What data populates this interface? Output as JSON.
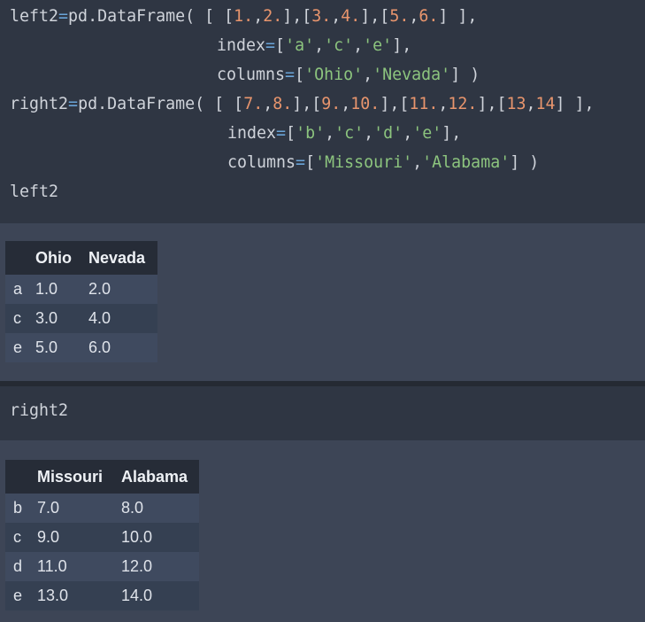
{
  "cell1": {
    "lines": [
      [
        {
          "t": "ident",
          "v": "left2"
        },
        {
          "t": "op",
          "v": "="
        },
        {
          "t": "ident",
          "v": "pd"
        },
        {
          "t": "punc",
          "v": "."
        },
        {
          "t": "ident",
          "v": "DataFrame"
        },
        {
          "t": "punc",
          "v": "( [ ["
        },
        {
          "t": "num",
          "v": "1."
        },
        {
          "t": "punc",
          "v": ","
        },
        {
          "t": "num",
          "v": "2."
        },
        {
          "t": "punc",
          "v": "],["
        },
        {
          "t": "num",
          "v": "3."
        },
        {
          "t": "punc",
          "v": ","
        },
        {
          "t": "num",
          "v": "4."
        },
        {
          "t": "punc",
          "v": "],["
        },
        {
          "t": "num",
          "v": "5."
        },
        {
          "t": "punc",
          "v": ","
        },
        {
          "t": "num",
          "v": "6."
        },
        {
          "t": "punc",
          "v": "] ],"
        }
      ],
      [
        {
          "t": "ident",
          "v": "index"
        },
        {
          "t": "op",
          "v": "="
        },
        {
          "t": "punc",
          "v": "["
        },
        {
          "t": "str",
          "v": "'a'"
        },
        {
          "t": "punc",
          "v": ","
        },
        {
          "t": "str",
          "v": "'c'"
        },
        {
          "t": "punc",
          "v": ","
        },
        {
          "t": "str",
          "v": "'e'"
        },
        {
          "t": "punc",
          "v": "],"
        }
      ],
      [
        {
          "t": "ident",
          "v": "columns"
        },
        {
          "t": "op",
          "v": "="
        },
        {
          "t": "punc",
          "v": "["
        },
        {
          "t": "str",
          "v": "'Ohio'"
        },
        {
          "t": "punc",
          "v": ","
        },
        {
          "t": "str",
          "v": "'Nevada'"
        },
        {
          "t": "punc",
          "v": "] )"
        }
      ],
      [
        {
          "t": "ident",
          "v": "right2"
        },
        {
          "t": "op",
          "v": "="
        },
        {
          "t": "ident",
          "v": "pd"
        },
        {
          "t": "punc",
          "v": "."
        },
        {
          "t": "ident",
          "v": "DataFrame"
        },
        {
          "t": "punc",
          "v": "( [ ["
        },
        {
          "t": "num",
          "v": "7."
        },
        {
          "t": "punc",
          "v": ","
        },
        {
          "t": "num",
          "v": "8."
        },
        {
          "t": "punc",
          "v": "],["
        },
        {
          "t": "num",
          "v": "9."
        },
        {
          "t": "punc",
          "v": ","
        },
        {
          "t": "num",
          "v": "10."
        },
        {
          "t": "punc",
          "v": "],["
        },
        {
          "t": "num",
          "v": "11."
        },
        {
          "t": "punc",
          "v": ","
        },
        {
          "t": "num",
          "v": "12."
        },
        {
          "t": "punc",
          "v": "],["
        },
        {
          "t": "num",
          "v": "13"
        },
        {
          "t": "punc",
          "v": ","
        },
        {
          "t": "num",
          "v": "14"
        },
        {
          "t": "punc",
          "v": "] ],"
        }
      ],
      [
        {
          "t": "ident",
          "v": "index"
        },
        {
          "t": "op",
          "v": "="
        },
        {
          "t": "punc",
          "v": "["
        },
        {
          "t": "str",
          "v": "'b'"
        },
        {
          "t": "punc",
          "v": ","
        },
        {
          "t": "str",
          "v": "'c'"
        },
        {
          "t": "punc",
          "v": ","
        },
        {
          "t": "str",
          "v": "'d'"
        },
        {
          "t": "punc",
          "v": ","
        },
        {
          "t": "str",
          "v": "'e'"
        },
        {
          "t": "punc",
          "v": "],"
        }
      ],
      [
        {
          "t": "ident",
          "v": "columns"
        },
        {
          "t": "op",
          "v": "="
        },
        {
          "t": "punc",
          "v": "["
        },
        {
          "t": "str",
          "v": "'Missouri'"
        },
        {
          "t": "punc",
          "v": ","
        },
        {
          "t": "str",
          "v": "'Alabama'"
        },
        {
          "t": "punc",
          "v": "] )"
        }
      ],
      [
        {
          "t": "ident",
          "v": "left2"
        }
      ]
    ]
  },
  "table1": {
    "columns": [
      "",
      "Ohio",
      "Nevada"
    ],
    "rows": [
      [
        "a",
        "1.0",
        "2.0"
      ],
      [
        "c",
        "3.0",
        "4.0"
      ],
      [
        "e",
        "5.0",
        "6.0"
      ]
    ]
  },
  "cell2": {
    "lines": [
      [
        {
          "t": "ident",
          "v": "right2"
        }
      ]
    ]
  },
  "table2": {
    "columns": [
      "",
      "Missouri",
      "Alabama"
    ],
    "rows": [
      [
        "b",
        "7.0",
        "8.0"
      ],
      [
        "c",
        "9.0",
        "10.0"
      ],
      [
        "d",
        "11.0",
        "12.0"
      ],
      [
        "e",
        "13.0",
        "14.0"
      ]
    ]
  },
  "colors": {
    "code_bg": "#2f3643",
    "output_bg": "#3d4556",
    "number": "#e8956d",
    "string": "#8cc47e",
    "operator": "#6aa4d8",
    "text": "#cfd3da"
  }
}
